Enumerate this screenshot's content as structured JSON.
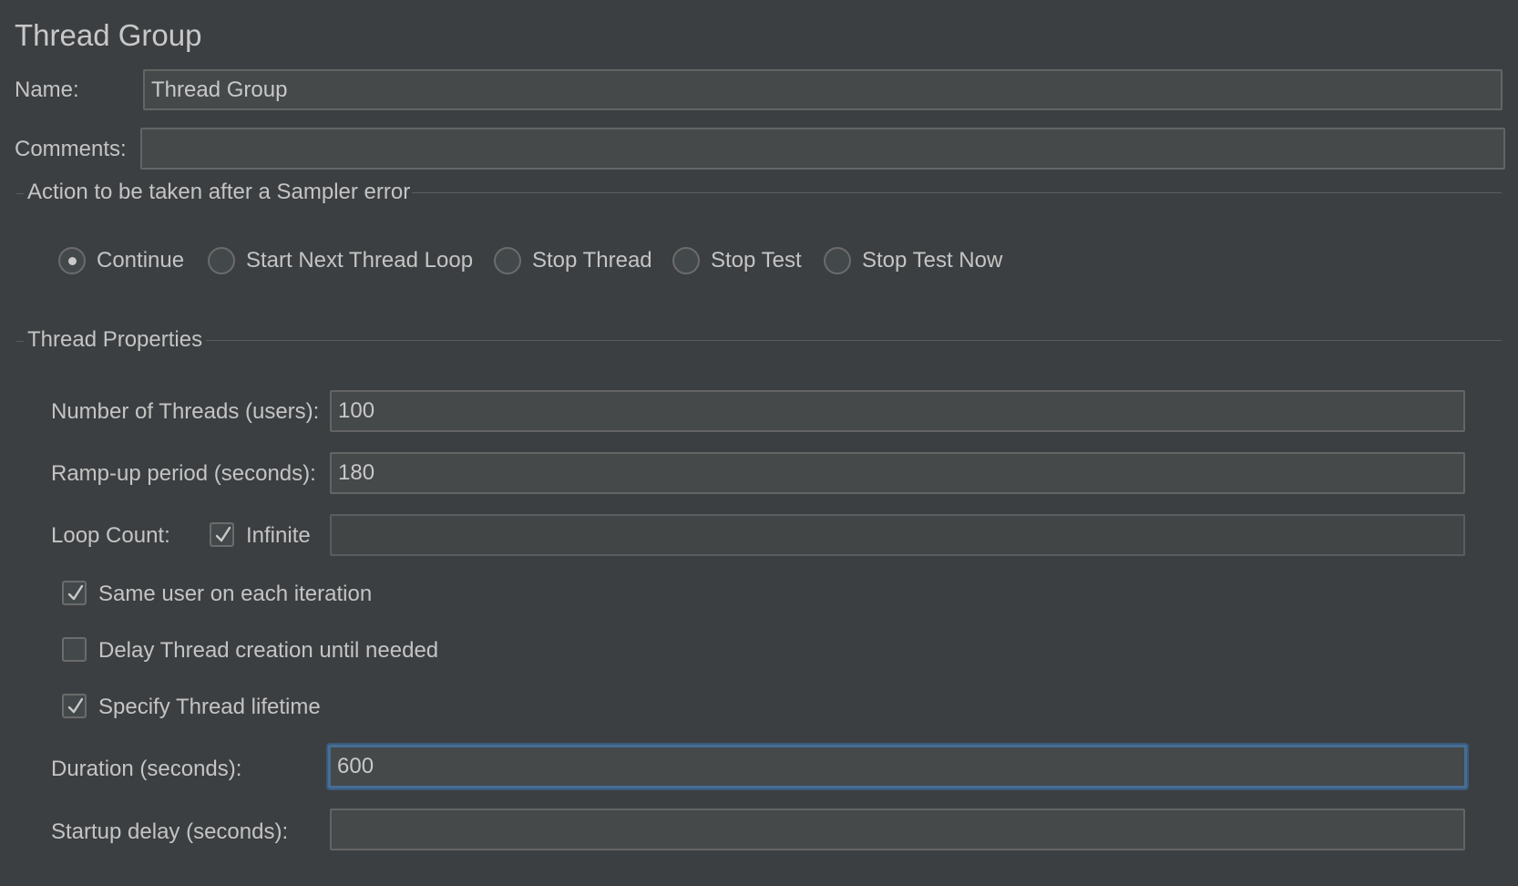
{
  "panel": {
    "title": "Thread Group",
    "name_label": "Name:",
    "name_value": "Thread Group",
    "comments_label": "Comments:",
    "comments_value": ""
  },
  "sampler_error": {
    "section_label": "Action to be taken after a Sampler error",
    "options": [
      {
        "label": "Continue",
        "selected": true
      },
      {
        "label": "Start Next Thread Loop",
        "selected": false
      },
      {
        "label": "Stop Thread",
        "selected": false
      },
      {
        "label": "Stop Test",
        "selected": false
      },
      {
        "label": "Stop Test Now",
        "selected": false
      }
    ]
  },
  "thread_properties": {
    "section_label": "Thread Properties",
    "num_threads_label": "Number of Threads (users):",
    "num_threads_value": "100",
    "rampup_label": "Ramp-up period (seconds):",
    "rampup_value": "180",
    "loop_count_label": "Loop Count:",
    "infinite_label": "Infinite",
    "infinite_checked": true,
    "loop_count_value": "",
    "same_user_label": "Same user on each iteration",
    "same_user_checked": true,
    "delay_creation_label": "Delay Thread creation until needed",
    "delay_creation_checked": false,
    "specify_lifetime_label": "Specify Thread lifetime",
    "specify_lifetime_checked": true,
    "duration_label": "Duration (seconds):",
    "duration_value": "600",
    "startup_delay_label": "Startup delay (seconds):",
    "startup_delay_value": ""
  },
  "colors": {
    "background": "#3c3f41",
    "field": "#45494a",
    "focus_border": "#466d94",
    "text": "#c4c4c4"
  }
}
